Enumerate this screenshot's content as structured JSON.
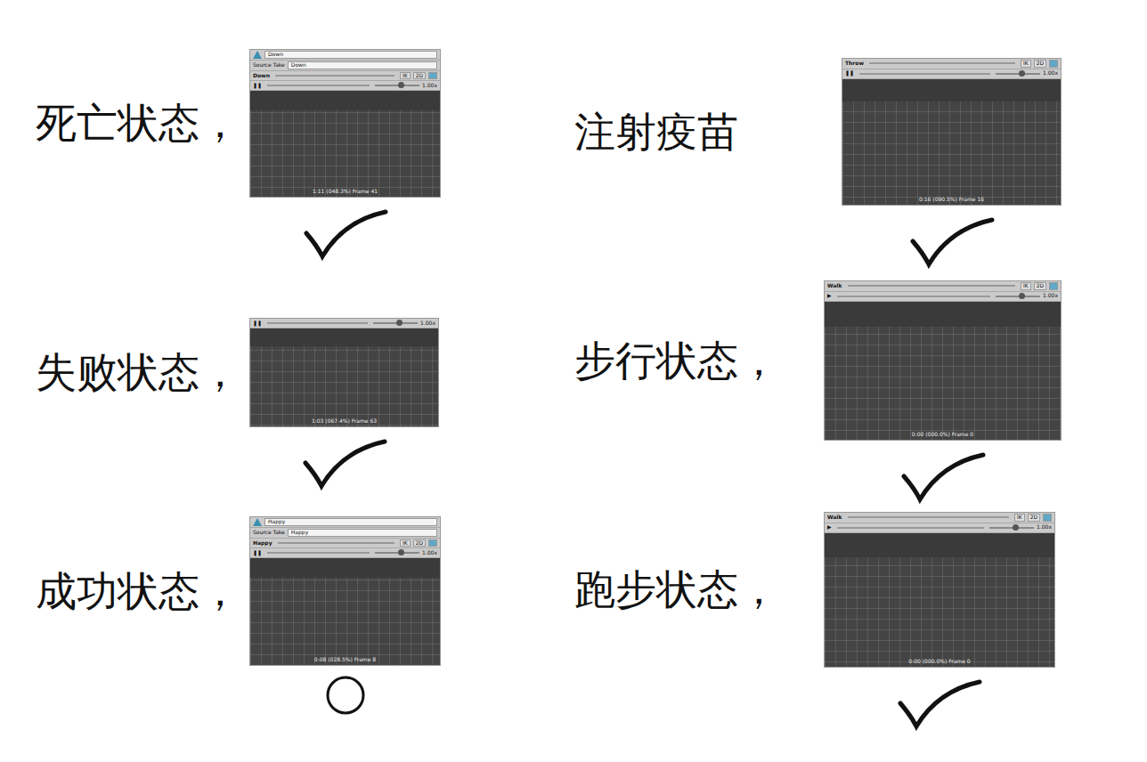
{
  "columns": [
    [
      {
        "label": "死亡状态，",
        "mark": "check",
        "preview": {
          "name_field": "Down",
          "source_take": {
            "label": "Source Take",
            "value": "Down"
          },
          "clip": "Down",
          "tools": [
            "IK",
            "2D"
          ],
          "control": "❚❚",
          "speed": "1.00x",
          "readout": "1:11 (048.3%) Frame 41"
        }
      },
      {
        "label": "失败状态，",
        "mark": "check",
        "preview": {
          "control": "❚❚",
          "speed": "1.00x",
          "readout": "1:03 (067.4%) Frame 63"
        }
      },
      {
        "label": "成功状态，",
        "mark": "circle",
        "preview": {
          "name_field": "Happy",
          "source_take": {
            "label": "Source Take",
            "value": "Happy"
          },
          "clip": "Happy",
          "tools": [
            "IK",
            "2D"
          ],
          "control": "❚❚",
          "speed": "1.00x",
          "readout": "0:08 (028.5%) Frame 8"
        }
      }
    ],
    [
      {
        "label": "注射疫苗",
        "mark": "check",
        "preview": {
          "clip": "Throw",
          "tools": [
            "IK",
            "2D"
          ],
          "control": "❚❚",
          "speed": "1.00x",
          "readout": "0:16 (090.5%) Frame 16"
        }
      },
      {
        "label": "步行状态，",
        "mark": "check",
        "preview": {
          "clip": "Walk",
          "tools": [
            "IK",
            "2D"
          ],
          "control": "▶",
          "speed": "1.00x",
          "readout": "0:00 (000.0%) Frame 0"
        }
      },
      {
        "label": "跑步状态，",
        "mark": "check",
        "preview": {
          "clip": "Walk",
          "tools": [
            "IK",
            "2D"
          ],
          "control": "▶",
          "speed": "1.00x",
          "readout": "0:00 (000.0%) Frame 0"
        }
      }
    ]
  ]
}
